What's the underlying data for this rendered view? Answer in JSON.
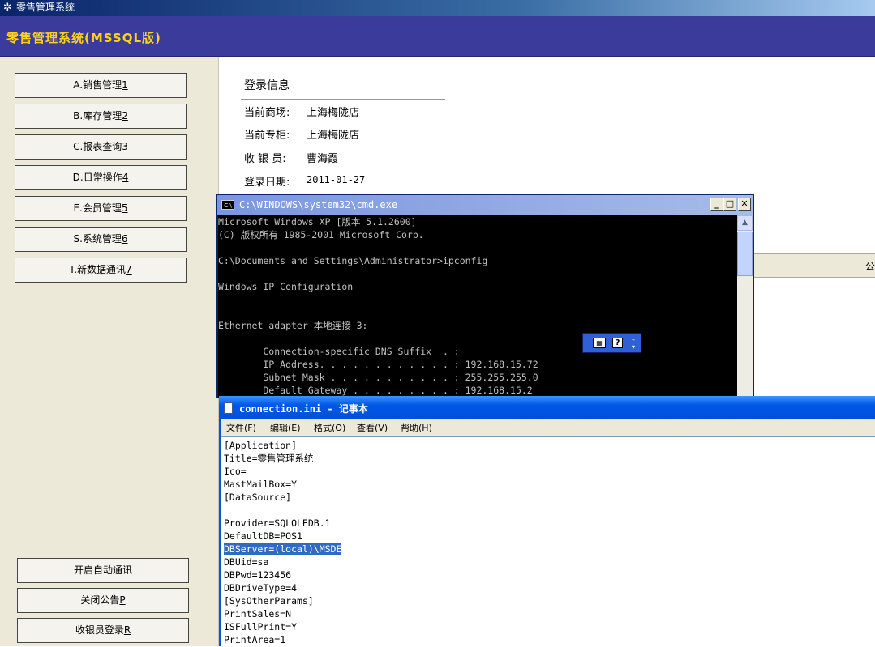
{
  "app": {
    "window_title": "零售管理系统",
    "banner": "零售管理系统(MSSQL版)"
  },
  "nav": [
    {
      "prefix": "A.销售管理",
      "key": "1"
    },
    {
      "prefix": "B.库存管理",
      "key": "2"
    },
    {
      "prefix": "C.报表查询",
      "key": "3"
    },
    {
      "prefix": "D.日常操作",
      "key": "4"
    },
    {
      "prefix": "E.会员管理",
      "key": "5"
    },
    {
      "prefix": "S.系统管理",
      "key": "6"
    },
    {
      "prefix": "T.新数据通讯",
      "key": "7"
    }
  ],
  "bottom_buttons": {
    "auto_comm": "开启自动通讯",
    "close_notice": {
      "prefix": "关闭公告",
      "key": "P"
    },
    "cashier_login": {
      "prefix": "收银员登录",
      "key": "R"
    }
  },
  "login_info": {
    "title": "登录信息",
    "rows": [
      {
        "label": "当前商场:",
        "value": "上海梅陇店"
      },
      {
        "label": "当前专柜:",
        "value": "上海梅陇店"
      },
      {
        "label": "收 银 员:",
        "value": "曹海霞"
      },
      {
        "label": "登录日期:",
        "value": "2011-01-27"
      }
    ]
  },
  "right_strip_text": "公",
  "cmd": {
    "title": "C:\\WINDOWS\\system32\\cmd.exe",
    "lines": [
      "Microsoft Windows XP [版本 5.1.2600]",
      "(C) 版权所有 1985-2001 Microsoft Corp.",
      "",
      "C:\\Documents and Settings\\Administrator>ipconfig",
      "",
      "Windows IP Configuration",
      "",
      "",
      "Ethernet adapter 本地连接 3:",
      "",
      "        Connection-specific DNS Suffix  . :",
      "        IP Address. . . . . . . . . . . . : 192.168.15.72",
      "        Subnet Mask . . . . . . . . . . . : 255.255.255.0",
      "        Default Gateway . . . . . . . . . : 192.168.15.2"
    ]
  },
  "ime": {
    "keyboard_icon": "keyboard-icon",
    "help_icon": "help-icon",
    "help_glyph": "?"
  },
  "notepad": {
    "title": "connection.ini - 记事本",
    "menu": [
      {
        "label": "文件",
        "key": "F"
      },
      {
        "label": "编辑",
        "key": "E"
      },
      {
        "label": "格式",
        "key": "O"
      },
      {
        "label": "查看",
        "key": "V"
      },
      {
        "label": "帮助",
        "key": "H"
      }
    ],
    "lines": [
      "[Application]",
      "Title=零售管理系统",
      "Ico=",
      "MastMailBox=Y",
      "[DataSource]",
      "",
      "Provider=SQLOLEDB.1",
      "DefaultDB=POS1",
      "DBServer=(local)\\MSDE",
      "DBUid=sa",
      "DBPwd=123456",
      "DBDriveType=4",
      "[SysOtherParams]",
      "PrintSales=N",
      "ISFullPrint=Y",
      "PrintArea=1"
    ],
    "selected_line": 8
  }
}
